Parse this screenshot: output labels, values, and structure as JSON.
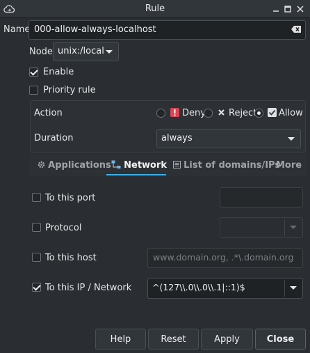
{
  "window": {
    "title": "Rule",
    "app_icon": "cloud-sync-icon",
    "controls": [
      "minimize-icon",
      "maximize-icon",
      "close-icon"
    ]
  },
  "name": {
    "label": "Name",
    "value": "000-allow-always-localhost"
  },
  "node": {
    "label": "Node",
    "value": "unix:/local"
  },
  "enable": {
    "label": "Enable",
    "checked": true
  },
  "priority": {
    "label": "Priority rule",
    "checked": false
  },
  "action": {
    "label": "Action",
    "options": [
      {
        "label": "Deny",
        "icon": "deny-icon",
        "selected": false
      },
      {
        "label": "Reject",
        "icon": "reject-x-icon",
        "selected": false
      },
      {
        "label": "Allow",
        "icon": "allow-check-icon",
        "selected": true
      }
    ]
  },
  "duration": {
    "label": "Duration",
    "value": "always"
  },
  "tabs": [
    {
      "label": "Applications",
      "icon": "gear-icon",
      "active": false
    },
    {
      "label": "Network",
      "icon": "network-icon",
      "active": true
    },
    {
      "label": "List of domains/IPs",
      "icon": "list-icon",
      "active": false
    },
    {
      "label": "More",
      "active": false
    }
  ],
  "network": {
    "port": {
      "label": "To this port",
      "checked": false,
      "value": ""
    },
    "protocol": {
      "label": "Protocol",
      "checked": false,
      "value": ""
    },
    "host": {
      "label": "To this host",
      "checked": false,
      "placeholder": "www.domain.org, .*\\.domain.org"
    },
    "ip": {
      "label": "To this IP / Network",
      "checked": true,
      "value": "^(127\\\\.0\\\\.0\\\\.1|::1)$"
    }
  },
  "buttons": {
    "help": "Help",
    "reset": "Reset",
    "apply": "Apply",
    "close": "Close"
  },
  "colors": {
    "background": "#2a2e32",
    "accent": "#3daee9",
    "deny": "#da4453"
  }
}
